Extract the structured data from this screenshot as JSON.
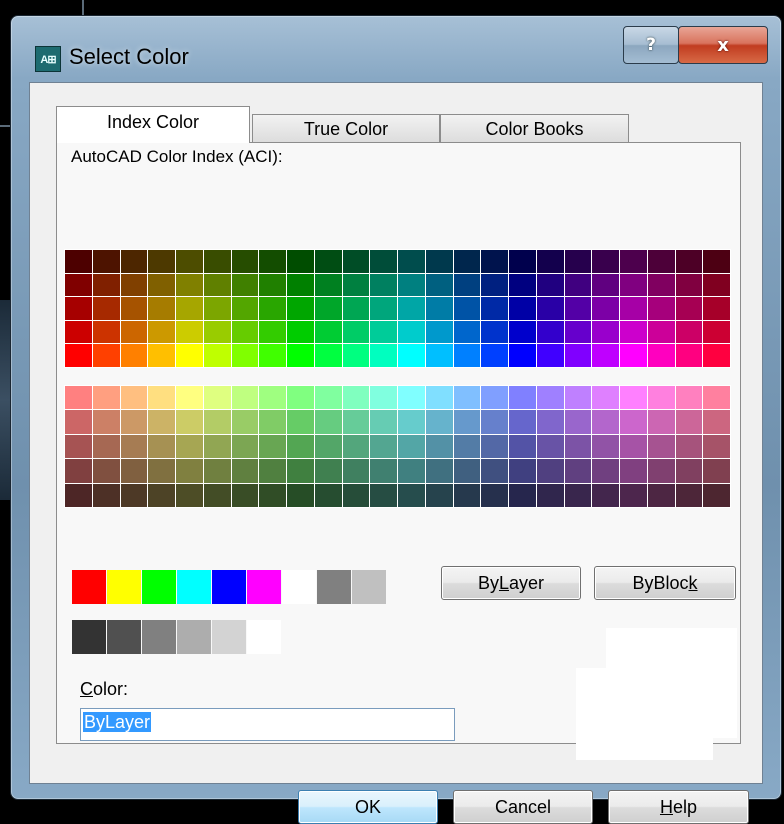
{
  "window": {
    "title": "Select Color",
    "help_caption": "?",
    "close_caption": "x"
  },
  "tabs": [
    {
      "label": "Index Color",
      "active": true
    },
    {
      "label": "True Color",
      "active": false
    },
    {
      "label": "Color Books",
      "active": false
    }
  ],
  "aci_label": "AutoCAD Color Index (ACI):",
  "bylayer_button": {
    "before": "By",
    "mnemonic": "L",
    "after": "ayer"
  },
  "byblock_button": {
    "before": "ByBloc",
    "mnemonic": "k",
    "after": ""
  },
  "color_field": {
    "label_mnemonic": "C",
    "label_rest": "olor:",
    "value": "ByLayer"
  },
  "buttons": {
    "ok": "OK",
    "cancel": "Cancel",
    "help_mnemonic": "H",
    "help_rest": "elp"
  },
  "standard_colors": [
    "#ff0000",
    "#ffff00",
    "#00ff00",
    "#00ffff",
    "#0000ff",
    "#ff00ff",
    "#ffffff",
    "#808080",
    "#c0c0c0"
  ],
  "gray_shades": [
    "#333333",
    "#505050",
    "#808080",
    "#adadad",
    "#d3d3d3",
    "#ffffff"
  ],
  "preview_color": "#ffffff",
  "selection_color": "#3399ff"
}
